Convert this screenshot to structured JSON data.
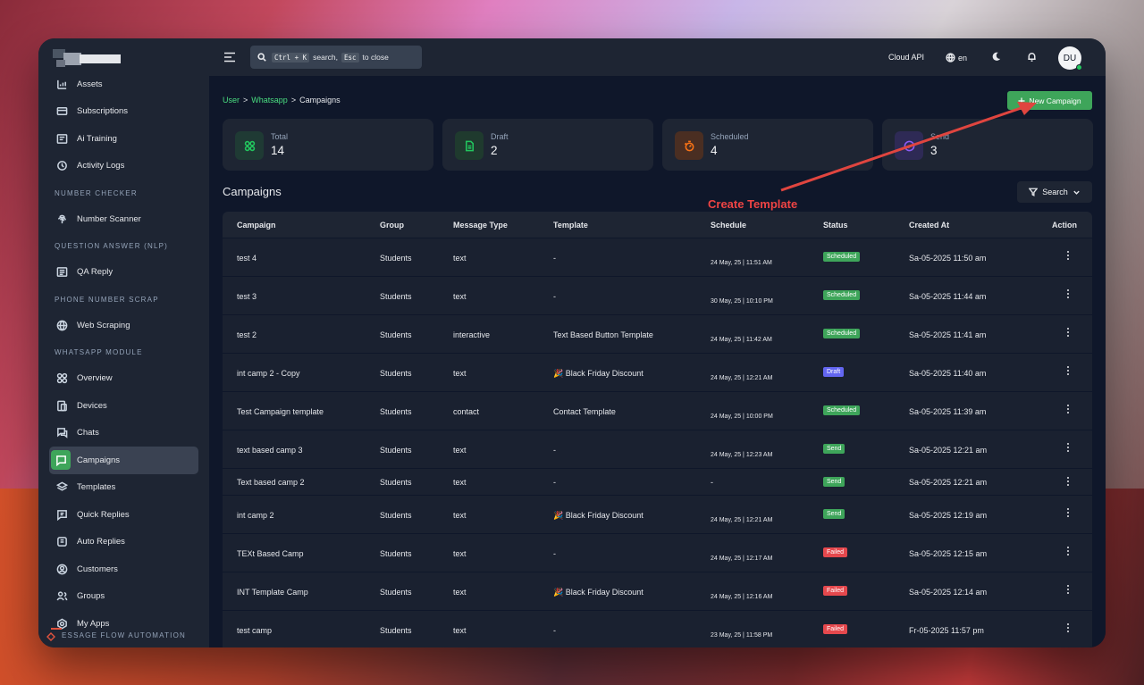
{
  "header": {
    "search_ctrl": "Ctrl + K",
    "search_text": "search,",
    "search_esc": "Esc",
    "search_close": "to close",
    "cloud_api": "Cloud API",
    "lang": "en",
    "avatar": "DU"
  },
  "sidebar": {
    "top_items": [
      {
        "label": "Assets",
        "icon": "chart-icon"
      },
      {
        "label": "Subscriptions",
        "icon": "card-icon"
      },
      {
        "label": "Ai Training",
        "icon": "board-icon"
      },
      {
        "label": "Activity Logs",
        "icon": "history-icon"
      }
    ],
    "sections": [
      {
        "title": "NUMBER CHECKER",
        "items": [
          {
            "label": "Number Scanner",
            "icon": "fingerprint-icon"
          }
        ]
      },
      {
        "title": "QUESTION ANSWER (NLP)",
        "items": [
          {
            "label": "QA Reply",
            "icon": "list-icon"
          }
        ]
      },
      {
        "title": "PHONE NUMBER SCRAP",
        "items": [
          {
            "label": "Web Scraping",
            "icon": "globe-icon"
          }
        ]
      },
      {
        "title": "WHATSAPP MODULE",
        "items": [
          {
            "label": "Overview",
            "icon": "grid-icon"
          },
          {
            "label": "Devices",
            "icon": "devices-icon"
          },
          {
            "label": "Chats",
            "icon": "chat-icon"
          },
          {
            "label": "Campaigns",
            "icon": "message-icon",
            "active": true
          },
          {
            "label": "Templates",
            "icon": "layers-icon"
          },
          {
            "label": "Quick Replies",
            "icon": "quick-reply-icon"
          },
          {
            "label": "Auto Replies",
            "icon": "auto-reply-icon"
          },
          {
            "label": "Customers",
            "icon": "user-circle-icon"
          },
          {
            "label": "Groups",
            "icon": "users-icon"
          },
          {
            "label": "My Apps",
            "icon": "apps-icon"
          }
        ]
      }
    ],
    "footer": "ESSAGE FLOW AUTOMATION"
  },
  "breadcrumb": {
    "user": "User",
    "whatsapp": "Whatsapp",
    "current": "Campaigns",
    "separator": ">"
  },
  "new_campaign": "New Campaign",
  "stats": [
    {
      "label": "Total",
      "value": "14",
      "color": "#22c55e",
      "bg": "#1f3a34",
      "icon": "grid-icon"
    },
    {
      "label": "Draft",
      "value": "2",
      "color": "#22c55e",
      "bg": "#1f3a2e",
      "icon": "document-icon"
    },
    {
      "label": "Scheduled",
      "value": "4",
      "color": "#f97316",
      "bg": "#4a2e22",
      "icon": "timer-icon"
    },
    {
      "label": "Send",
      "value": "3",
      "color": "#8b5cf6",
      "bg": "#2e2a55",
      "icon": "check-circle-icon"
    }
  ],
  "page_title": "Campaigns",
  "search_button": "Search",
  "annotation": "Create Template",
  "table": {
    "headers": [
      "Campaign",
      "Group",
      "Message Type",
      "Template",
      "Schedule",
      "Status",
      "Created At",
      "Action"
    ],
    "rows": [
      {
        "campaign": "test 4",
        "group": "Students",
        "type": "text",
        "template": "-",
        "schedule": "24 May, 25 | 11:51 AM",
        "status": "Scheduled",
        "created": "Sa-05-2025 11:50 am"
      },
      {
        "campaign": "test 3",
        "group": "Students",
        "type": "text",
        "template": "-",
        "schedule": "30 May, 25 | 10:10 PM",
        "status": "Scheduled",
        "created": "Sa-05-2025 11:44 am"
      },
      {
        "campaign": "test 2",
        "group": "Students",
        "type": "interactive",
        "template": "Text Based Button Template",
        "schedule": "24 May, 25 | 11:42 AM",
        "status": "Scheduled",
        "created": "Sa-05-2025 11:41 am"
      },
      {
        "campaign": "int camp 2 - Copy",
        "group": "Students",
        "type": "text",
        "template": "🎉 Black Friday Discount",
        "schedule": "24 May, 25 | 12:21 AM",
        "status": "Draft",
        "created": "Sa-05-2025 11:40 am"
      },
      {
        "campaign": "Test Campaign template",
        "group": "Students",
        "type": "contact",
        "template": "Contact Template",
        "schedule": "24 May, 25 | 10:00 PM",
        "status": "Scheduled",
        "created": "Sa-05-2025 11:39 am"
      },
      {
        "campaign": "text based camp 3",
        "group": "Students",
        "type": "text",
        "template": "-",
        "schedule": "24 May, 25 | 12:23 AM",
        "status": "Send",
        "created": "Sa-05-2025 12:21 am"
      },
      {
        "campaign": "Text based camp 2",
        "group": "Students",
        "type": "text",
        "template": "-",
        "schedule": "-",
        "status": "Send",
        "created": "Sa-05-2025 12:21 am",
        "short": true
      },
      {
        "campaign": "int camp 2",
        "group": "Students",
        "type": "text",
        "template": "🎉 Black Friday Discount",
        "schedule": "24 May, 25 | 12:21 AM",
        "status": "Send",
        "created": "Sa-05-2025 12:19 am"
      },
      {
        "campaign": "TEXt Based Camp",
        "group": "Students",
        "type": "text",
        "template": "-",
        "schedule": "24 May, 25 | 12:17 AM",
        "status": "Failed",
        "created": "Sa-05-2025 12:15 am"
      },
      {
        "campaign": "INT Template Camp",
        "group": "Students",
        "type": "text",
        "template": "🎉 Black Friday Discount",
        "schedule": "24 May, 25 | 12:16 AM",
        "status": "Failed",
        "created": "Sa-05-2025 12:14 am"
      },
      {
        "campaign": "test camp",
        "group": "Students",
        "type": "text",
        "template": "-",
        "schedule": "23 May, 25 | 11:58 PM",
        "status": "Failed",
        "created": "Fr-05-2025 11:57 pm"
      }
    ]
  }
}
